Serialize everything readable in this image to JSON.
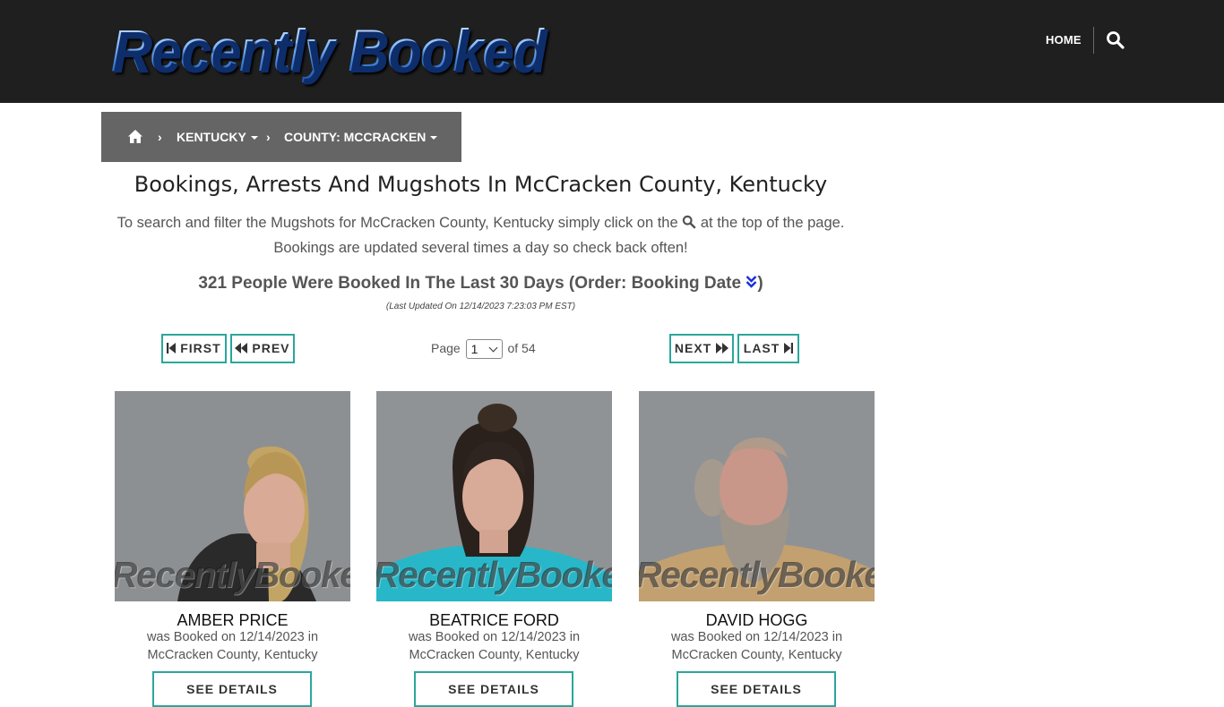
{
  "header": {
    "logo_text": "Recently Booked",
    "nav_home": "HOME",
    "search_icon": "search-icon"
  },
  "breadcrumb": {
    "home_icon": "home-icon",
    "state": "KENTUCKY",
    "county": "COUNTY: MCCRACKEN"
  },
  "main": {
    "title": "Bookings, Arrests And Mugshots In McCracken County, Kentucky",
    "intro_line1_before": "To search and filter the Mugshots for McCracken County, Kentucky simply click on the",
    "intro_line1_after": "at the top of the page.",
    "intro_line2": "Bookings are updated several times a day so check back often!",
    "count_text": "321 People Were Booked In The Last 30 Days (Order: Booking Date",
    "count_close": ")",
    "last_updated": "(Last Updated On 12/14/2023 7:23:03 PM EST)"
  },
  "pagination": {
    "first": "FIRST",
    "prev": "PREV",
    "next": "NEXT",
    "last": "LAST",
    "page_label": "Page",
    "current_page": "1",
    "of_label": "of 54"
  },
  "bookings": [
    {
      "name": "AMBER PRICE",
      "line1": "was Booked on 12/14/2023 in",
      "line2": "McCracken County, Kentucky",
      "button": "SEE DETAILS",
      "watermark": "RecentlyBooked.com"
    },
    {
      "name": "BEATRICE FORD",
      "line1": "was Booked on 12/14/2023 in",
      "line2": "McCracken County, Kentucky",
      "button": "SEE DETAILS",
      "watermark": "RecentlyBooked.com"
    },
    {
      "name": "DAVID HOGG",
      "line1": "was Booked on 12/14/2023 in",
      "line2": "McCracken County, Kentucky",
      "button": "SEE DETAILS",
      "watermark": "RecentlyBooked.com"
    }
  ],
  "colors": {
    "header_bg": "#1f1f1f",
    "breadcrumb_bg": "#656565",
    "button_border": "#2aa79b",
    "order_toggle": "#1a2fd8"
  }
}
